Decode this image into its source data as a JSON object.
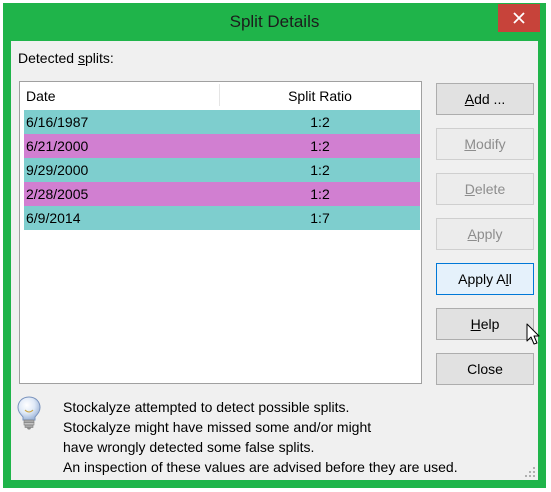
{
  "window": {
    "title": "Split Details",
    "close_glyph": "✕"
  },
  "colors": {
    "title_bar": "#1fb44a",
    "row_teal": "#7ecece",
    "row_magenta": "#d17fd1",
    "close_button": "#c7433a"
  },
  "caption": {
    "before": "Detected ",
    "underlined": "s",
    "after": "plits:"
  },
  "table": {
    "headers": {
      "date": "Date",
      "ratio": "Split Ratio"
    },
    "rows": [
      {
        "date": "6/16/1987",
        "ratio": "1:2",
        "color": "teal"
      },
      {
        "date": "6/21/2000",
        "ratio": "1:2",
        "color": "magenta"
      },
      {
        "date": "9/29/2000",
        "ratio": "1:2",
        "color": "teal"
      },
      {
        "date": "2/28/2005",
        "ratio": "1:2",
        "color": "magenta"
      },
      {
        "date": "6/9/2014",
        "ratio": "1:7",
        "color": "teal"
      }
    ]
  },
  "buttons": {
    "add": {
      "u": "A",
      "rest": "dd ..."
    },
    "modify": {
      "u": "M",
      "rest": "odify"
    },
    "delete": {
      "u": "D",
      "rest": "elete"
    },
    "apply": {
      "u": "A",
      "rest": "pply"
    },
    "apply_all": {
      "pre": "Apply A",
      "u": "l",
      "post": "l"
    },
    "help": {
      "u": "H",
      "rest": "elp"
    },
    "close": {
      "label": "Close"
    }
  },
  "info": {
    "icon": "lightbulb-icon",
    "lines": [
      "Stockalyze attempted to detect possible splits.",
      "Stockalyze might have missed some and/or might",
      "have wrongly detected some false splits.",
      "An inspection of these values are advised before they are used."
    ]
  }
}
